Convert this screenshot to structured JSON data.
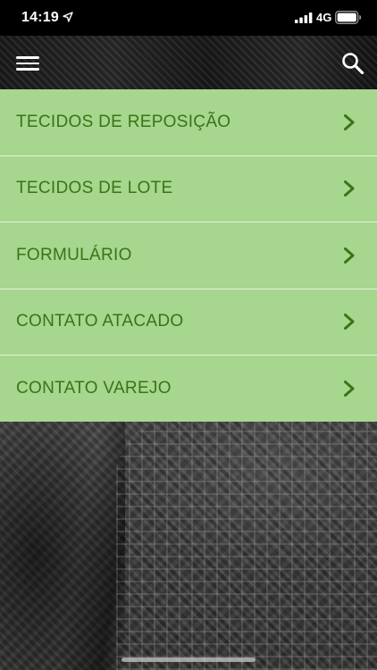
{
  "status_bar": {
    "time": "14:19",
    "network": "4G",
    "icons": [
      "location-arrow-icon",
      "signal-bars-icon",
      "battery-icon"
    ]
  },
  "header": {
    "icons": [
      "hamburger-menu-icon",
      "search-icon"
    ]
  },
  "menu": {
    "items": [
      {
        "label": "TECIDOS DE REPOSIÇÃO",
        "icon": "chevron-right-icon"
      },
      {
        "label": "TECIDOS DE LOTE",
        "icon": "chevron-right-icon"
      },
      {
        "label": "FORMULÁRIO",
        "icon": "chevron-right-icon"
      },
      {
        "label": "CONTATO ATACADO",
        "icon": "chevron-right-icon"
      },
      {
        "label": "CONTATO VAREJO",
        "icon": "chevron-right-icon"
      }
    ]
  },
  "colors": {
    "menu_background": "#a7d68e",
    "menu_text": "#3b7317",
    "divider": "#e6f2de",
    "status_bar": "#000000"
  }
}
